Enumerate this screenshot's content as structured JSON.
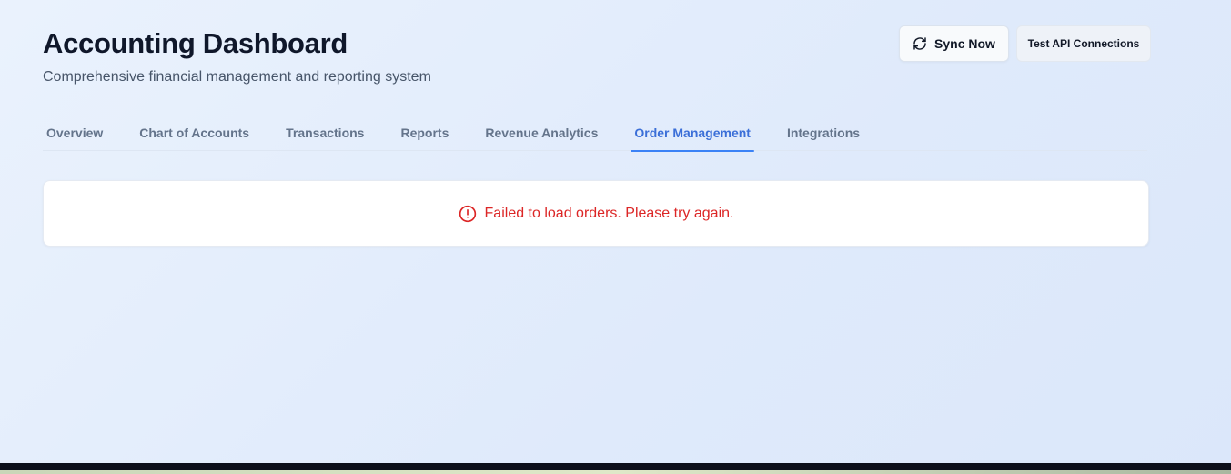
{
  "header": {
    "title": "Accounting Dashboard",
    "subtitle": "Comprehensive financial management and reporting system"
  },
  "actions": {
    "sync_label": "Sync Now",
    "sync_icon": "refresh-icon",
    "test_label": "Test API Connections"
  },
  "tabs": [
    {
      "label": "Overview",
      "active": false
    },
    {
      "label": "Chart of Accounts",
      "active": false
    },
    {
      "label": "Transactions",
      "active": false
    },
    {
      "label": "Reports",
      "active": false
    },
    {
      "label": "Revenue Analytics",
      "active": false
    },
    {
      "label": "Order Management",
      "active": true
    },
    {
      "label": "Integrations",
      "active": false
    }
  ],
  "error": {
    "icon": "alert-circle-icon",
    "message": "Failed to load orders. Please try again."
  },
  "colors": {
    "accent": "#3b6fd8",
    "error": "#dc2626"
  }
}
